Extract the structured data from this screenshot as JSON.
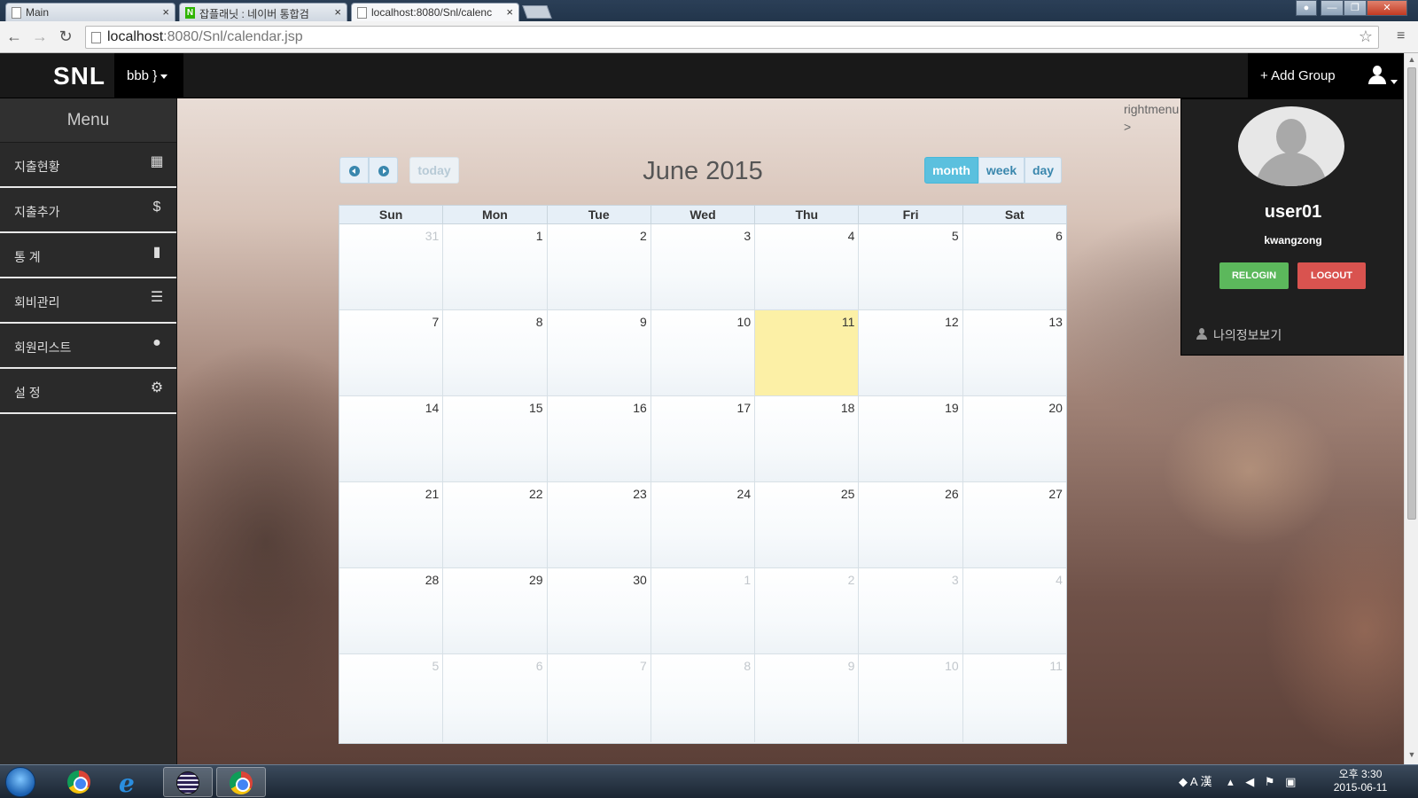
{
  "browser": {
    "tabs": [
      {
        "label": "Main"
      },
      {
        "label": "잡플래닛 : 네이버 통합검",
        "favicon": "N"
      },
      {
        "label": "localhost:8080/Snl/calenc"
      }
    ],
    "url_host": "localhost",
    "url_rest": ":8080/Snl/calendar.jsp"
  },
  "app": {
    "brand": "SNL",
    "group_label": "bbb }",
    "add_group_label": "+ Add Group"
  },
  "sidebar": {
    "title": "Menu",
    "items": [
      {
        "label": "지출현황",
        "icon": "calendar-icon"
      },
      {
        "label": "지출추가",
        "icon": "dollar-icon"
      },
      {
        "label": "통 계",
        "icon": "bar-chart-icon"
      },
      {
        "label": "회비관리",
        "icon": "list-icon"
      },
      {
        "label": "회원리스트",
        "icon": "user-icon"
      },
      {
        "label": "설 정",
        "icon": "gear-icon"
      }
    ]
  },
  "right_menu_text": [
    "rightmenu",
    ">"
  ],
  "calendar": {
    "title": "June 2015",
    "today_label": "today",
    "views": [
      {
        "label": "month",
        "active": true
      },
      {
        "label": "week",
        "active": false
      },
      {
        "label": "day",
        "active": false
      }
    ],
    "weekdays": [
      "Sun",
      "Mon",
      "Tue",
      "Wed",
      "Thu",
      "Fri",
      "Sat"
    ],
    "weeks": [
      [
        {
          "d": "31",
          "other": true
        },
        {
          "d": "1"
        },
        {
          "d": "2"
        },
        {
          "d": "3"
        },
        {
          "d": "4"
        },
        {
          "d": "5"
        },
        {
          "d": "6"
        }
      ],
      [
        {
          "d": "7"
        },
        {
          "d": "8"
        },
        {
          "d": "9"
        },
        {
          "d": "10"
        },
        {
          "d": "11",
          "today": true
        },
        {
          "d": "12"
        },
        {
          "d": "13"
        }
      ],
      [
        {
          "d": "14"
        },
        {
          "d": "15"
        },
        {
          "d": "16"
        },
        {
          "d": "17"
        },
        {
          "d": "18"
        },
        {
          "d": "19"
        },
        {
          "d": "20"
        }
      ],
      [
        {
          "d": "21"
        },
        {
          "d": "22"
        },
        {
          "d": "23"
        },
        {
          "d": "24"
        },
        {
          "d": "25"
        },
        {
          "d": "26"
        },
        {
          "d": "27"
        }
      ],
      [
        {
          "d": "28"
        },
        {
          "d": "29"
        },
        {
          "d": "30"
        },
        {
          "d": "1",
          "other": true
        },
        {
          "d": "2",
          "other": true
        },
        {
          "d": "3",
          "other": true
        },
        {
          "d": "4",
          "other": true
        }
      ],
      [
        {
          "d": "5",
          "other": true
        },
        {
          "d": "6",
          "other": true
        },
        {
          "d": "7",
          "other": true
        },
        {
          "d": "8",
          "other": true
        },
        {
          "d": "9",
          "other": true
        },
        {
          "d": "10",
          "other": true
        },
        {
          "d": "11",
          "other": true
        }
      ]
    ]
  },
  "user_panel": {
    "username": "user01",
    "role": "kwangzong",
    "relogin_label": "RELOGIN",
    "logout_label": "LOGOUT",
    "myinfo_label": "나의정보보기"
  },
  "taskbar": {
    "clock_time": "오후 3:30",
    "clock_date": "2015-06-11",
    "ime_label": "A 漢"
  },
  "colors": {
    "today_highlight": "#fcf0a6",
    "active_view": "#5bc0de",
    "relogin": "#5cb85c",
    "logout": "#d9534f"
  }
}
